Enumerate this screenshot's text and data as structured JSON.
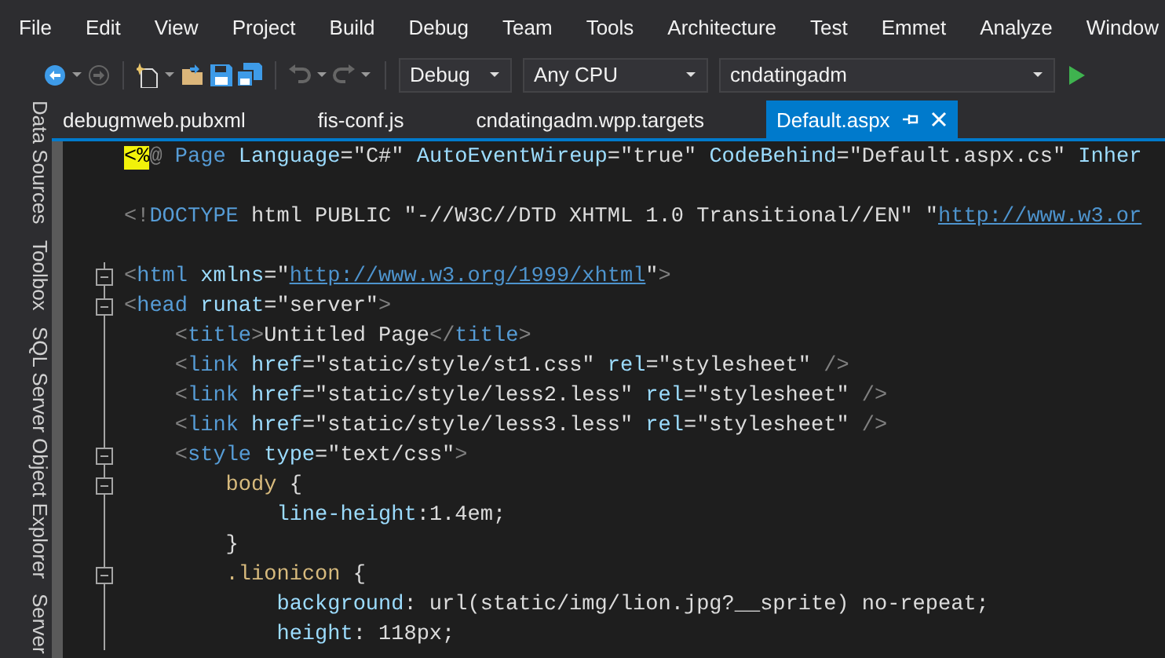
{
  "menu": [
    "File",
    "Edit",
    "View",
    "Project",
    "Build",
    "Debug",
    "Team",
    "Tools",
    "Architecture",
    "Test",
    "Emmet",
    "Analyze",
    "Window"
  ],
  "toolbar": {
    "configuration": "Debug",
    "platform": "Any CPU",
    "startup_project": "cndatingadm"
  },
  "side_tabs": [
    "Data Sources",
    "Toolbox",
    "SQL Server Object Explorer",
    "Server"
  ],
  "tabs": [
    {
      "label": "debugmweb.pubxml",
      "selected": false
    },
    {
      "label": "fis-conf.js",
      "selected": false
    },
    {
      "label": "cndatingadm.wpp.targets",
      "selected": false
    },
    {
      "label": "Default.aspx",
      "selected": true
    }
  ],
  "code_lines": [
    {
      "foldable": false,
      "tokens": [
        {
          "kind": "directive",
          "text": "<%"
        },
        {
          "kind": "punct",
          "text": "@"
        },
        {
          "kind": "tag",
          "text": " Page"
        },
        {
          "kind": "attr",
          "text": " Language"
        },
        {
          "kind": "text",
          "text": "=\"C#\""
        },
        {
          "kind": "attr",
          "text": " AutoEventWireup"
        },
        {
          "kind": "text",
          "text": "=\"true\""
        },
        {
          "kind": "attr",
          "text": " CodeBehind"
        },
        {
          "kind": "text",
          "text": "=\"Default.aspx.cs\""
        },
        {
          "kind": "attr",
          "text": " Inher"
        }
      ]
    },
    {
      "foldable": false
    },
    {
      "foldable": false,
      "tokens": [
        {
          "kind": "punct",
          "text": "<!"
        },
        {
          "kind": "tag",
          "text": "DOCTYPE"
        },
        {
          "kind": "text",
          "text": " html PUBLIC \"-//W3C//DTD XHTML 1.0 Transitional//EN\" \""
        },
        {
          "kind": "link",
          "text": "http://www.w3.or"
        }
      ]
    },
    {
      "foldable": false
    },
    {
      "foldable": true,
      "tokens": [
        {
          "kind": "punct",
          "text": "<"
        },
        {
          "kind": "tag",
          "text": "html"
        },
        {
          "kind": "attr",
          "text": " xmlns"
        },
        {
          "kind": "text",
          "text": "=\""
        },
        {
          "kind": "link",
          "text": "http://www.w3.org/1999/xhtml"
        },
        {
          "kind": "text",
          "text": "\""
        },
        {
          "kind": "punct",
          "text": ">"
        }
      ]
    },
    {
      "foldable": true,
      "tokens": [
        {
          "kind": "punct",
          "text": "<"
        },
        {
          "kind": "tag",
          "text": "head"
        },
        {
          "kind": "attr",
          "text": " runat"
        },
        {
          "kind": "text",
          "text": "=\"server\""
        },
        {
          "kind": "punct",
          "text": ">"
        }
      ]
    },
    {
      "foldable": false,
      "tokens": [
        {
          "kind": "punct",
          "text": "    <"
        },
        {
          "kind": "tag",
          "text": "title"
        },
        {
          "kind": "punct",
          "text": ">"
        },
        {
          "kind": "text",
          "text": "Untitled Page"
        },
        {
          "kind": "punct",
          "text": "</"
        },
        {
          "kind": "tag",
          "text": "title"
        },
        {
          "kind": "punct",
          "text": ">"
        }
      ]
    },
    {
      "foldable": false,
      "tokens": [
        {
          "kind": "punct",
          "text": "    <"
        },
        {
          "kind": "tag",
          "text": "link"
        },
        {
          "kind": "attr",
          "text": " href"
        },
        {
          "kind": "text",
          "text": "=\"static/style/st1.css\""
        },
        {
          "kind": "attr",
          "text": " rel"
        },
        {
          "kind": "text",
          "text": "=\"stylesheet\""
        },
        {
          "kind": "punct",
          "text": " />"
        }
      ]
    },
    {
      "foldable": false,
      "tokens": [
        {
          "kind": "punct",
          "text": "    <"
        },
        {
          "kind": "tag",
          "text": "link"
        },
        {
          "kind": "attr",
          "text": " href"
        },
        {
          "kind": "text",
          "text": "=\"static/style/less2.less\""
        },
        {
          "kind": "attr",
          "text": " rel"
        },
        {
          "kind": "text",
          "text": "=\"stylesheet\""
        },
        {
          "kind": "punct",
          "text": " />"
        }
      ]
    },
    {
      "foldable": false,
      "tokens": [
        {
          "kind": "punct",
          "text": "    <"
        },
        {
          "kind": "tag",
          "text": "link"
        },
        {
          "kind": "attr",
          "text": " href"
        },
        {
          "kind": "text",
          "text": "=\"static/style/less3.less\""
        },
        {
          "kind": "attr",
          "text": " rel"
        },
        {
          "kind": "text",
          "text": "=\"stylesheet\""
        },
        {
          "kind": "punct",
          "text": " />"
        }
      ]
    },
    {
      "foldable": true,
      "tokens": [
        {
          "kind": "punct",
          "text": "    <"
        },
        {
          "kind": "tag",
          "text": "style"
        },
        {
          "kind": "attr",
          "text": " type"
        },
        {
          "kind": "text",
          "text": "=\"text/css\""
        },
        {
          "kind": "punct",
          "text": ">"
        }
      ]
    },
    {
      "foldable": true,
      "tokens": [
        {
          "kind": "selector",
          "text": "        body"
        },
        {
          "kind": "text",
          "text": " {"
        }
      ]
    },
    {
      "foldable": false,
      "tokens": [
        {
          "kind": "attr",
          "text": "            line-height"
        },
        {
          "kind": "text",
          "text": ":1.4em;"
        }
      ]
    },
    {
      "foldable": false,
      "tokens": [
        {
          "kind": "text",
          "text": "        }"
        }
      ]
    },
    {
      "foldable": true,
      "tokens": [
        {
          "kind": "selector",
          "text": "        .lionicon"
        },
        {
          "kind": "text",
          "text": " {"
        }
      ]
    },
    {
      "foldable": false,
      "tokens": [
        {
          "kind": "attr",
          "text": "            background"
        },
        {
          "kind": "text",
          "text": ": url(static/img/lion.jpg?__sprite) no-repeat;"
        }
      ]
    },
    {
      "foldable": false,
      "tokens": [
        {
          "kind": "attr",
          "text": "            height"
        },
        {
          "kind": "text",
          "text": ": 118px;"
        }
      ]
    }
  ]
}
